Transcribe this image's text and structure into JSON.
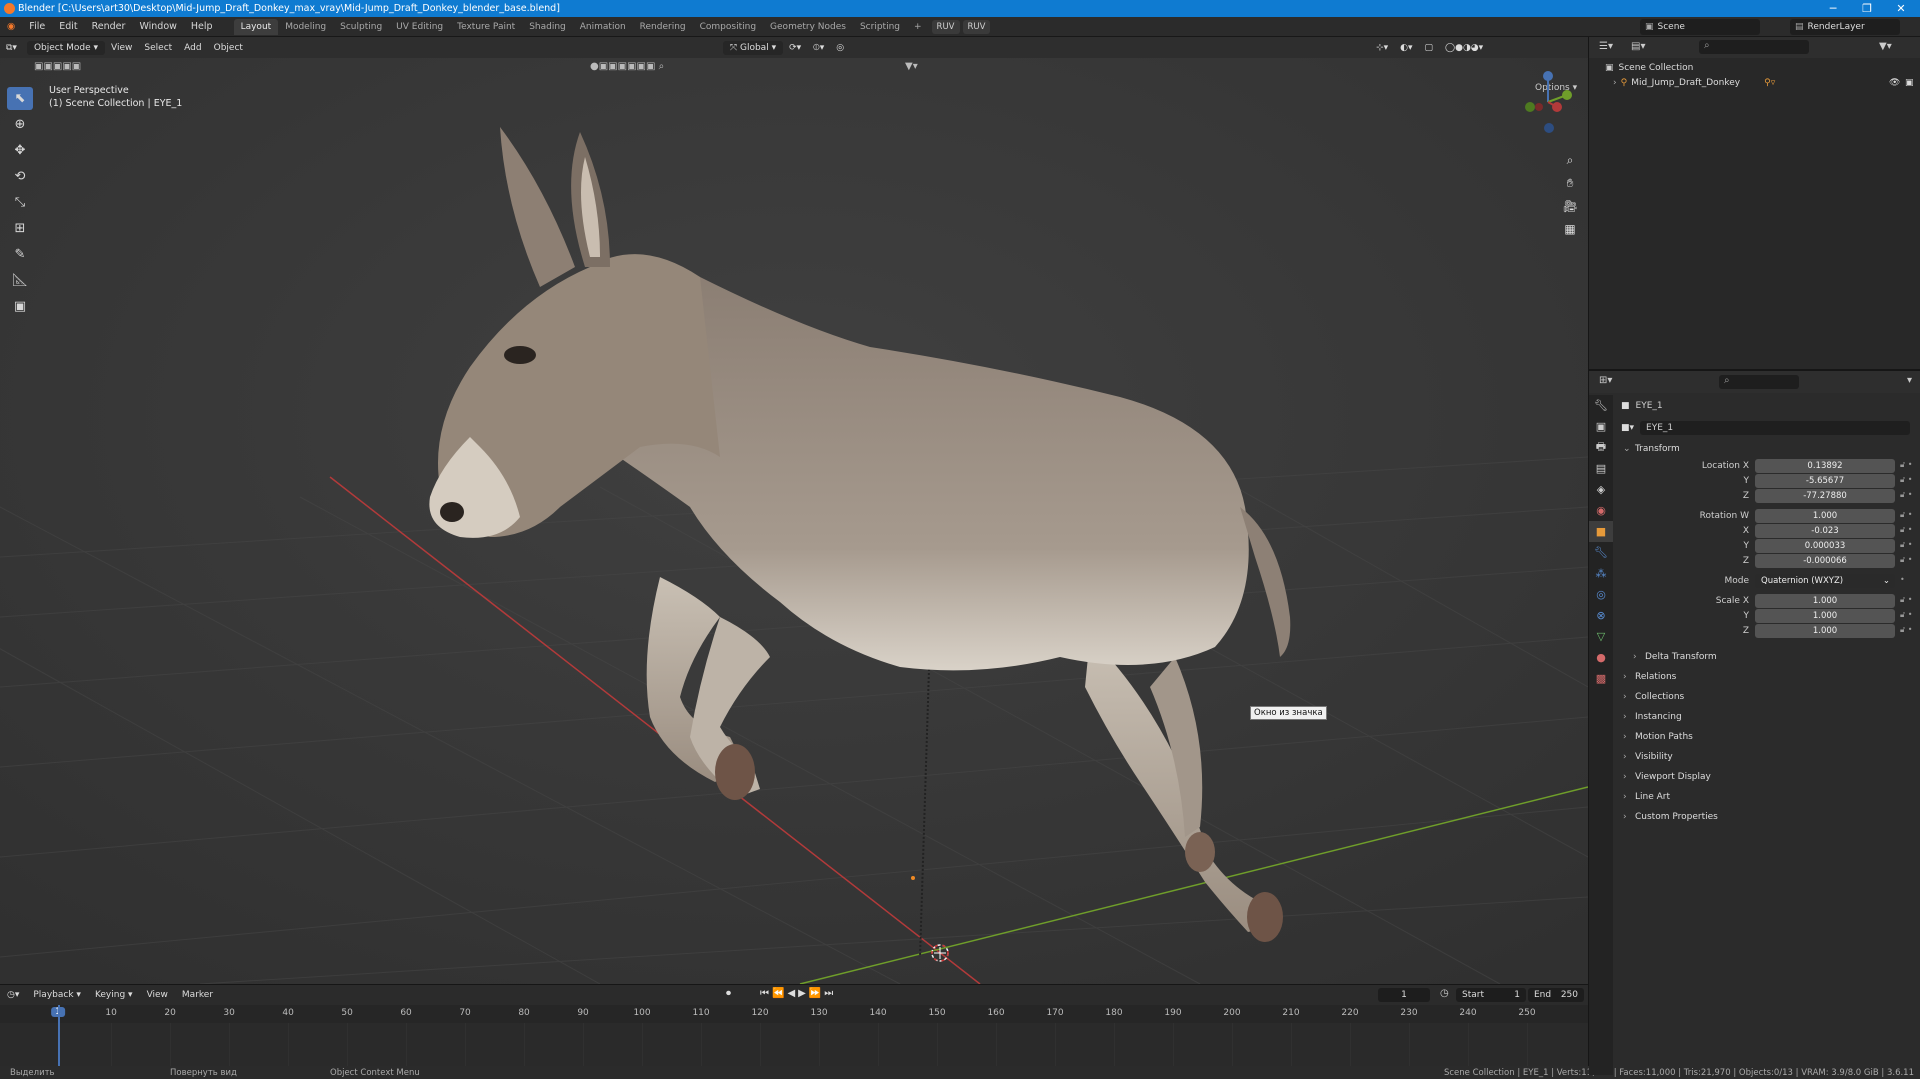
{
  "window": {
    "title": "Blender [C:\\Users\\art30\\Desktop\\Mid-Jump_Draft_Donkey_max_vray\\Mid-Jump_Draft_Donkey_blender_base.blend]",
    "minimize": "─",
    "maximize": "❐",
    "close": "✕"
  },
  "menu": [
    "File",
    "Edit",
    "Render",
    "Window",
    "Help"
  ],
  "workspaces": [
    "Layout",
    "Modeling",
    "Sculpting",
    "UV Editing",
    "Texture Paint",
    "Shading",
    "Animation",
    "Rendering",
    "Compositing",
    "Geometry Nodes",
    "Scripting"
  ],
  "workspace_add": "+",
  "ruv_buttons": [
    "RUV",
    "RUV"
  ],
  "scene": {
    "name": "Scene",
    "render_layer": "RenderLayer"
  },
  "viewport": {
    "mode": "Object Mode",
    "menus": [
      "View",
      "Select",
      "Add",
      "Object"
    ],
    "orientation": "Global",
    "options": "Options",
    "perspective": "User Perspective",
    "collection_info": "(1) Scene Collection | EYE_1",
    "tooltip": "Окно из значка"
  },
  "timeline": {
    "menus": [
      "Playback",
      "Keying",
      "View",
      "Marker"
    ],
    "current_frame": "1",
    "start_label": "Start",
    "start": "1",
    "end_label": "End",
    "end": "250",
    "ticks": [
      "1",
      "10",
      "20",
      "30",
      "40",
      "50",
      "60",
      "70",
      "80",
      "90",
      "100",
      "110",
      "120",
      "130",
      "140",
      "150",
      "160",
      "170",
      "180",
      "190",
      "200",
      "210",
      "220",
      "230",
      "240",
      "250"
    ]
  },
  "outliner": {
    "root": "Scene Collection",
    "item": "Mid_Jump_Draft_Donkey"
  },
  "properties": {
    "object_name": "EYE_1",
    "data_name": "EYE_1",
    "transform_label": "Transform",
    "location_label": "Location X",
    "location": [
      "0.13892",
      "-5.65677",
      "-77.27880"
    ],
    "rotation_label": "Rotation W",
    "rotation": [
      "1.000",
      "-0.023",
      "0.000033",
      "-0.000066"
    ],
    "mode_label": "Mode",
    "mode_value": "Quaternion (WXYZ)",
    "scale_label": "Scale X",
    "scale": [
      "1.000",
      "1.000",
      "1.000"
    ],
    "axis_y": "Y",
    "axis_z": "Z",
    "axis_x": "X",
    "sections": [
      "Delta Transform",
      "Relations",
      "Collections",
      "Instancing",
      "Motion Paths",
      "Visibility",
      "Viewport Display",
      "Line Art",
      "Custom Properties"
    ]
  },
  "status": {
    "left1": "Выделить",
    "left2": "Повернуть вид",
    "left3": "Object Context Menu",
    "right": "Scene Collection | EYE_1 | Verts:11,336 | Faces:11,000 | Tris:21,970 | Objects:0/13 | VRAM: 3.9/8.0 GiB | 3.6.11"
  },
  "colors": {
    "accent": "#4772b3",
    "titlebar": "#0f7bd1",
    "x_axis": "#b23a3a",
    "y_axis": "#6f9e2a"
  }
}
